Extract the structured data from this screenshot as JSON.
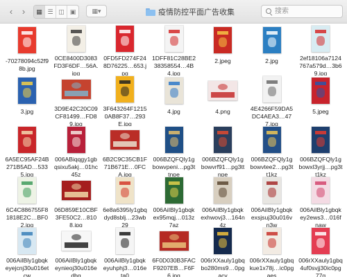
{
  "window": {
    "title": "疫情防控平面广告收集",
    "search_placeholder": "搜索",
    "nav_back_icon": "chevron-left-icon",
    "nav_forward_icon": "chevron-right-icon"
  },
  "colors": {
    "toolbar": "#e6e6e6",
    "folder": "#8cc0f0"
  },
  "files": [
    {
      "name": "-70278094c52f98b.jpg",
      "shape": "tall",
      "bg": "#e83b2e",
      "accent": "#ffffff",
      "icon": "poster-thumbnail"
    },
    {
      "name": "0CE8400D3083FD3F6DF…56A.jpg",
      "shape": "tall",
      "bg": "#f3efe6",
      "accent": "#3a3a3a",
      "icon": "poster-thumbnail"
    },
    {
      "name": "0FD5FD274F248D76225…653.jpg",
      "shape": "tall",
      "bg": "#d9272e",
      "accent": "#ffffff",
      "icon": "poster-thumbnail"
    },
    {
      "name": "1DFF81C28BE238358554…4B4.jpg",
      "shape": "tall",
      "bg": "#f4f4f4",
      "accent": "#d42a2a",
      "icon": "poster-thumbnail"
    },
    {
      "name": "2.jpeg",
      "shape": "tall",
      "bg": "#c92a23",
      "accent": "#f6c445",
      "icon": "poster-thumbnail"
    },
    {
      "name": "2.jpg",
      "shape": "tall",
      "bg": "#2c7fc2",
      "accent": "#ffffff",
      "icon": "poster-thumbnail"
    },
    {
      "name": "2ef18106a7124767a579d…3b69.jpg",
      "shape": "tall",
      "bg": "#d8ecf2",
      "accent": "#d62b2b",
      "icon": "poster-thumbnail"
    },
    {
      "name": "3.jpg",
      "shape": "tall",
      "bg": "#2b62b0",
      "accent": "#f3d046",
      "icon": "poster-thumbnail"
    },
    {
      "name": "3D9E42C20C09CF81499…FD89.jpg",
      "shape": "wide",
      "bg": "#c5432f",
      "accent": "#7fb0c9",
      "icon": "photo-thumbnail"
    },
    {
      "name": "3F643264F12150AB8F37…293E.jpg",
      "shape": "tall",
      "bg": "#f1b01d",
      "accent": "#222222",
      "icon": "poster-thumbnail"
    },
    {
      "name": "4.jpg",
      "shape": "tall",
      "bg": "#e9e4d8",
      "accent": "#2f79c9",
      "icon": "poster-thumbnail"
    },
    {
      "name": "4.png",
      "shape": "wide",
      "bg": "#f3e6e6",
      "accent": "#c42a2a",
      "icon": "poster-thumbnail"
    },
    {
      "name": "4E4266F59DA5DC4AEA3…477.jpg",
      "shape": "tall",
      "bg": "#f2f2f2",
      "accent": "#6a6a6a",
      "icon": "poster-thumbnail"
    },
    {
      "name": "5.jpeg",
      "shape": "tall",
      "bg": "#c8232c",
      "accent": "#2c55a8",
      "icon": "poster-thumbnail"
    },
    {
      "name": "6A5EC95AF24B271B5AD…5335.jpg",
      "shape": "tall",
      "bg": "#c9262a",
      "accent": "#f3d8b0",
      "icon": "poster-thumbnail"
    },
    {
      "name": "006ABiqqgy1gbqsixu5akj…01hc45z",
      "shape": "tall",
      "bg": "#b8203a",
      "accent": "#f5e6e0",
      "icon": "poster-thumbnail"
    },
    {
      "name": "6B2C9C35CB1F71B671E…0FCA.jpg",
      "shape": "wide",
      "bg": "#ba2d27",
      "accent": "#e9e0d0",
      "icon": "photo-thumbnail"
    },
    {
      "name": "006BZQFQly1gbowvpeni…pg3ttnpe",
      "shape": "tall",
      "bg": "#1f4f86",
      "accent": "#e8c06a",
      "icon": "poster-thumbnail"
    },
    {
      "name": "006BZQFQly1gbowvrf91…pg3ttnpe",
      "shape": "tall",
      "bg": "#2a3e5c",
      "accent": "#e04a2f",
      "icon": "poster-thumbnail"
    },
    {
      "name": "006BZQFQly1gbowvtee2…pg3tt1kz",
      "shape": "tall",
      "bg": "#234f87",
      "accent": "#f0c755",
      "icon": "poster-thumbnail"
    },
    {
      "name": "006BZQFQly1gbowxl3yrjj…pg3tt1kz",
      "shape": "tall",
      "bg": "#1e3f6e",
      "accent": "#e63a2e",
      "icon": "poster-thumbnail"
    },
    {
      "name": "6C4C886755F81818E2C…BF02.jpg",
      "shape": "tall",
      "bg": "#eef3e6",
      "accent": "#3e9a5a",
      "icon": "poster-thumbnail"
    },
    {
      "name": "06D859E10CBF3FE50C2…8108.jpg",
      "shape": "wide",
      "bg": "#a51e1e",
      "accent": "#f0d9a8",
      "icon": "photo-thumbnail"
    },
    {
      "name": "6e8a6395ly1gbqdyd8sblj…23wb29",
      "shape": "tall",
      "bg": "#efe3c8",
      "accent": "#d33b2c",
      "icon": "poster-thumbnail"
    },
    {
      "name": "006AiIBly1gbqkex95mqj…013z7az",
      "shape": "tall",
      "bg": "#2d6a34",
      "accent": "#e4d04c",
      "icon": "poster-thumbnail"
    },
    {
      "name": "006AiIBly1gbqkexhwovj3…164n4z",
      "shape": "tall",
      "bg": "#d8cfc0",
      "accent": "#5a4630",
      "icon": "poster-thumbnail"
    },
    {
      "name": "006AiIBly1gbqkexsjsuj30u016vn3w",
      "shape": "tall",
      "bg": "#e8e6e2",
      "accent": "#a52a2a",
      "icon": "poster-thumbnail"
    },
    {
      "name": "006AiIBly1gbqkey2ews3…016fnaw",
      "shape": "tall",
      "bg": "#f4dbe4",
      "accent": "#d2456e",
      "icon": "poster-thumbnail"
    },
    {
      "name": "006AiIBly1gbqkeyejcnj30u016etcw",
      "shape": "tall",
      "bg": "#d8e8f2",
      "accent": "#3a7fb8",
      "icon": "poster-thumbnail"
    },
    {
      "name": "006AiIBly1gbqkeynieoj30u016edhg",
      "shape": "wide",
      "bg": "#f7f7f7",
      "accent": "#222222",
      "icon": "poster-thumbnail"
    },
    {
      "name": "006AiIBly1gbqkeyuhphj3…016eta0",
      "shape": "tall",
      "bg": "#f5f5f5",
      "accent": "#1a1a1a",
      "icon": "poster-thumbnail"
    },
    {
      "name": "6F0D030B3FACF9207EB…F6F6.jpg",
      "shape": "wide",
      "bg": "#b52b24",
      "accent": "#eac27a",
      "icon": "photo-thumbnail"
    },
    {
      "name": "006rXXauly1gbqbo280ms9…0pgacv",
      "shape": "tall",
      "bg": "#152a4d",
      "accent": "#f1c23c",
      "icon": "poster-thumbnail"
    },
    {
      "name": "006rXXauly1gbqkue1x78j…ic0pgaes",
      "shape": "tall",
      "bg": "#f2ebe3",
      "accent": "#c8322b",
      "icon": "poster-thumbnail"
    },
    {
      "name": "006rXXauly1gbq4uf0svjj30ic0pg77g",
      "shape": "tall",
      "bg": "#e43d52",
      "accent": "#ffffff",
      "icon": "poster-thumbnail"
    }
  ]
}
